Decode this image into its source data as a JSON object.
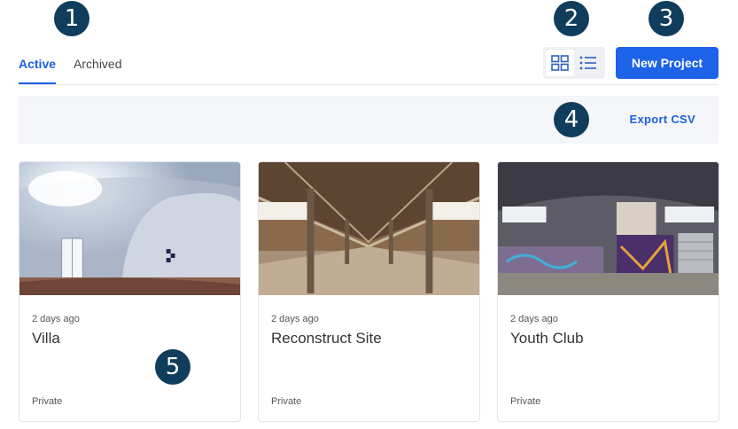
{
  "markers": [
    "1",
    "2",
    "3",
    "4",
    "5"
  ],
  "tabs": [
    {
      "label": "Active",
      "active": true
    },
    {
      "label": "Archived",
      "active": false
    }
  ],
  "view_toggle": {
    "grid_icon": "grid-icon",
    "list_icon": "list-icon",
    "selected": "grid"
  },
  "new_project_label": "New Project",
  "export_label": "Export CSV",
  "colors": {
    "accent": "#1d63e8",
    "marker": "#103d5c",
    "toolbar_bg": "#f4f6f9"
  },
  "projects": [
    {
      "date": "2 days ago",
      "title": "Villa",
      "privacy": "Private"
    },
    {
      "date": "2 days ago",
      "title": "Reconstruct Site",
      "privacy": "Private"
    },
    {
      "date": "2 days ago",
      "title": "Youth Club",
      "privacy": "Private"
    }
  ]
}
